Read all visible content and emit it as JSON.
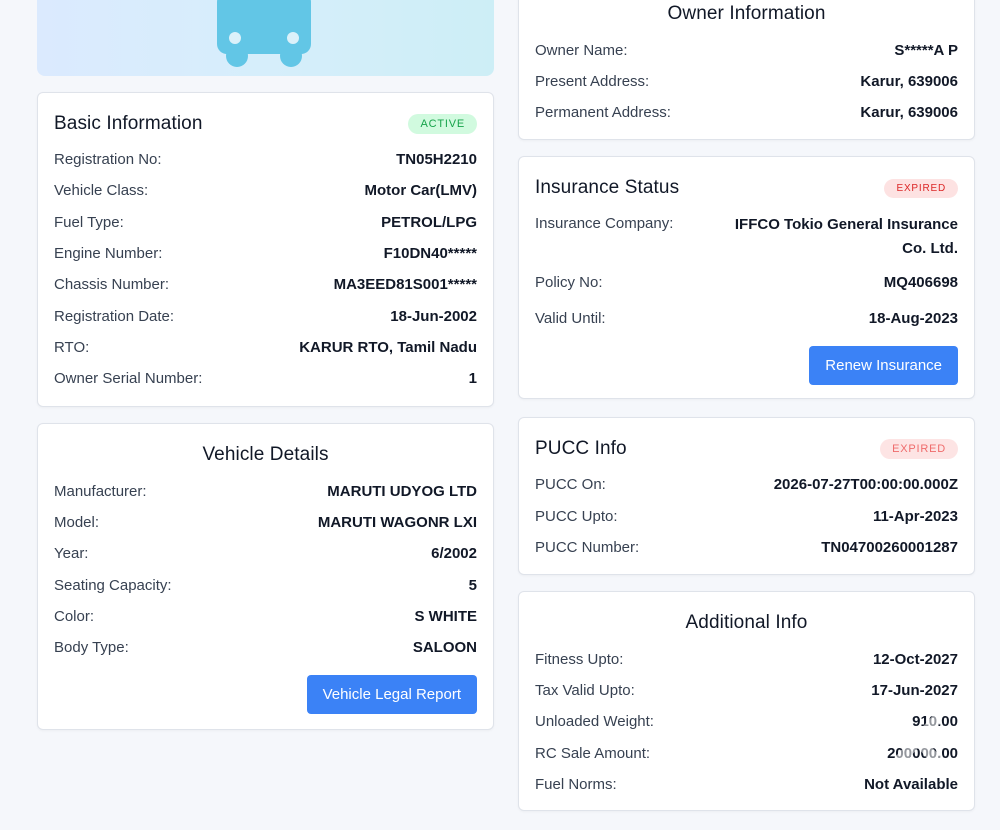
{
  "owner": {
    "title": "Owner Information",
    "rows": [
      {
        "label": "Owner Name:",
        "value": "S*****A P"
      },
      {
        "label": "Present Address:",
        "value": "Karur, 639006"
      },
      {
        "label": "Permanent Address:",
        "value": "Karur, 639006"
      }
    ]
  },
  "basic": {
    "title": "Basic Information",
    "status": "ACTIVE",
    "rows": [
      {
        "label": "Registration No:",
        "value": "TN05H2210"
      },
      {
        "label": "Vehicle Class:",
        "value": "Motor Car(LMV)"
      },
      {
        "label": "Fuel Type:",
        "value": "PETROL/LPG"
      },
      {
        "label": "Engine Number:",
        "value": "F10DN40*****"
      },
      {
        "label": "Chassis Number:",
        "value": "MA3EED81S001*****"
      },
      {
        "label": "Registration Date:",
        "value": "18-Jun-2002"
      },
      {
        "label": "RTO:",
        "value": "KARUR RTO, Tamil Nadu"
      },
      {
        "label": "Owner Serial Number:",
        "value": "1"
      }
    ]
  },
  "insurance": {
    "title": "Insurance Status",
    "status": "EXPIRED",
    "rows": [
      {
        "label": "Insurance Company:",
        "value": "IFFCO Tokio General Insurance Co. Ltd."
      },
      {
        "label": "Policy No:",
        "value": "MQ406698"
      },
      {
        "label": "Valid Until:",
        "value": "18-Aug-2023"
      }
    ],
    "button": "Renew Insurance"
  },
  "vehicle": {
    "title": "Vehicle Details",
    "rows": [
      {
        "label": "Manufacturer:",
        "value": "MARUTI UDYOG LTD"
      },
      {
        "label": "Model:",
        "value": "MARUTI WAGONR LXI"
      },
      {
        "label": "Year:",
        "value": "6/2002"
      },
      {
        "label": "Seating Capacity:",
        "value": "5"
      },
      {
        "label": "Color:",
        "value": "S WHITE"
      },
      {
        "label": "Body Type:",
        "value": "SALOON"
      }
    ],
    "button": "Vehicle Legal Report"
  },
  "pucc": {
    "title": "PUCC Info",
    "status": "EXPIRED",
    "rows": [
      {
        "label": "PUCC On:",
        "value": "2026-07-27T00:00:00.000Z"
      },
      {
        "label": "PUCC Upto:",
        "value": "11-Apr-2023"
      },
      {
        "label": "PUCC Number:",
        "value": "TN04700260001287"
      }
    ]
  },
  "additional": {
    "title": "Additional Info",
    "rows": [
      {
        "label": "Fitness Upto:",
        "value": "12-Oct-2027"
      },
      {
        "label": "Tax Valid Upto:",
        "value": "17-Jun-2027"
      },
      {
        "label": "Unloaded Weight:",
        "value": "910.00"
      },
      {
        "label": "RC Sale Amount:",
        "value": "200000.00"
      },
      {
        "label": "Fuel Norms:",
        "value": "Not Available"
      }
    ]
  },
  "icons": {
    "hero": "car-icon",
    "watermark": "olx-logo-icon"
  },
  "colors": {
    "accent": "#3b82f6",
    "active": "#16a34a",
    "expired": "#dc2626"
  }
}
